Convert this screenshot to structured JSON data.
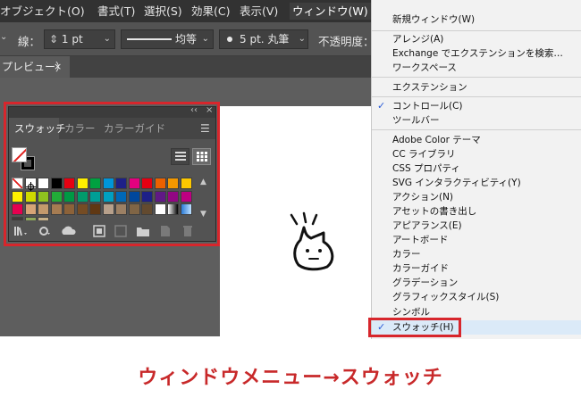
{
  "menubar": {
    "items": [
      "オブジェクト(O)",
      "書式(T)",
      "選択(S)",
      "効果(C)",
      "表示(V)",
      "ウィンドウ(W)"
    ]
  },
  "controlbar": {
    "stroke_label": "線：",
    "stroke_weight": "1 pt",
    "stroke_profile": "均等",
    "brush": "5 pt. 丸筆",
    "opacity_label": "不透明度："
  },
  "document_tab": {
    "title": "プレビュー）",
    "close": "×"
  },
  "swatches_panel": {
    "titlebar_collapse": "‹‹",
    "titlebar_close": "×",
    "tabs": [
      "スウォッチ",
      "カラー",
      "カラーガイド"
    ],
    "active_tab": "スウォッチ",
    "menu_icon": "menu-icon",
    "view_modes": [
      "list-view-icon",
      "grid-view-icon"
    ],
    "active_view": "grid-view-icon",
    "swatch_rows": [
      [
        "#ffffff",
        "#ffffff",
        "#ffffff",
        "#000000",
        "#e60012",
        "#ffee00",
        "#00a040",
        "#0095d9",
        "#1d2088",
        "#e4007f",
        "#e60012",
        "#eb6100",
        "#f39800",
        "#fcc800"
      ],
      [
        "#fff100",
        "#cfdb00",
        "#8fc31f",
        "#22ac38",
        "#009944",
        "#009b6b",
        "#009e96",
        "#00a0c1",
        "#0068b7",
        "#00479d",
        "#1d2088",
        "#601986",
        "#920783",
        "#be0081"
      ],
      [
        "#e5004f",
        "#d7a476",
        "#c49a6c",
        "#a67c52",
        "#8c6239",
        "#754c24",
        "#603813",
        "#b7a08b",
        "#9c8064",
        "#806545",
        "#634a2f",
        "#ffffff",
        "#bfbfbf",
        "#4d8fd3"
      ],
      [
        "#3e3a39",
        "#8fa85a",
        "#c7b189"
      ]
    ],
    "scroll_up": "▲",
    "scroll_down": "▼",
    "footer_icons": [
      "swatch-libraries-icon",
      "kind-menu-icon",
      "cc-library-icon",
      "swatch-options-icon",
      "color-group-icon",
      "new-group-icon",
      "new-swatch-icon",
      "delete-swatch-icon"
    ]
  },
  "window_menu": {
    "items": [
      {
        "label": "新規ウィンドウ(W)",
        "checked": false
      },
      {
        "label": "アレンジ(A)",
        "checked": false
      },
      {
        "label": "Exchange でエクステンションを検索…",
        "checked": false
      },
      {
        "label": "ワークスペース",
        "checked": false
      },
      {
        "label": "エクステンション",
        "checked": false
      },
      {
        "label": "コントロール(C)",
        "checked": true
      },
      {
        "label": "ツールバー",
        "checked": false
      },
      {
        "label": "Adobe Color テーマ",
        "checked": false
      },
      {
        "label": "CC ライブラリ",
        "checked": false
      },
      {
        "label": "CSS プロパティ",
        "checked": false
      },
      {
        "label": "SVG インタラクティビティ(Y)",
        "checked": false
      },
      {
        "label": "アクション(N)",
        "checked": false
      },
      {
        "label": "アセットの書き出し",
        "checked": false
      },
      {
        "label": "アピアランス(E)",
        "checked": false
      },
      {
        "label": "アートボード",
        "checked": false
      },
      {
        "label": "カラー",
        "checked": false
      },
      {
        "label": "カラーガイド",
        "checked": false
      },
      {
        "label": "グラデーション",
        "checked": false
      },
      {
        "label": "グラフィックスタイル(S)",
        "checked": false
      },
      {
        "label": "シンボル",
        "checked": false
      },
      {
        "label": "スウォッチ(H)",
        "checked": true
      }
    ],
    "check_glyph": "✓"
  },
  "colors": {
    "highlight": "#d7262c",
    "caption": "#c8292a",
    "menu_check": "#2a5bd7"
  },
  "caption": "ウィンドウメニュー→スウォッチ"
}
